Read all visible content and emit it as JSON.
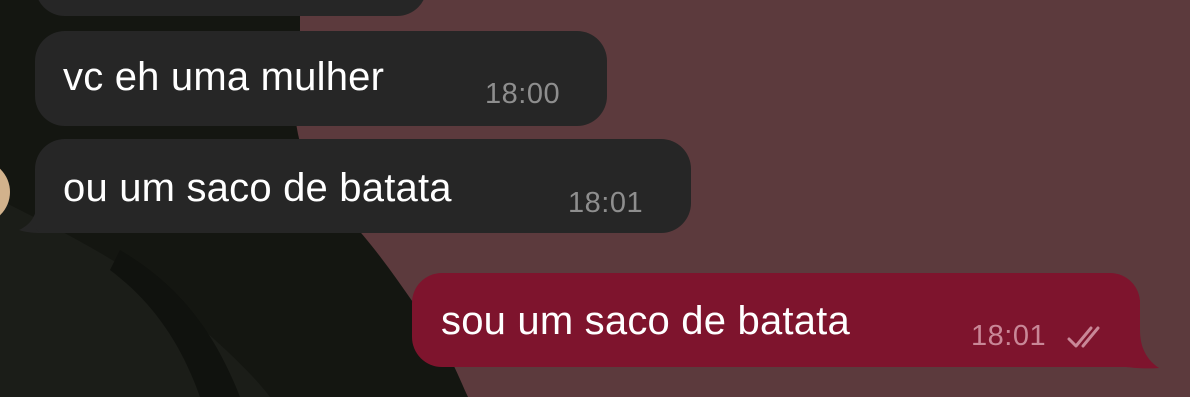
{
  "chat": {
    "messages": [
      {
        "direction": "incoming",
        "text": "vc eh uma mulher",
        "time": "18:00"
      },
      {
        "direction": "incoming",
        "text": "ou um saco de batata",
        "time": "18:01"
      },
      {
        "direction": "outgoing",
        "text": "sou um saco de batata",
        "time": "18:01",
        "status_icon": "double-check-icon"
      }
    ]
  },
  "colors": {
    "wallpaper": "#5c3a3d",
    "incoming_bubble": "#262626",
    "outgoing_bubble": "#7e142d",
    "incoming_time": "#8e8e8e",
    "outgoing_time": "#c98797"
  }
}
